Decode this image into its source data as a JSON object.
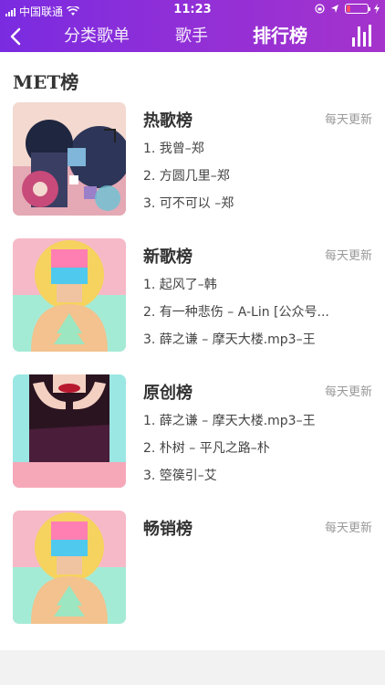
{
  "status": {
    "carrier": "中国联通",
    "time": "11:23"
  },
  "nav": {
    "back": "<",
    "tabs": [
      "分类歌单",
      "歌手",
      "排行榜"
    ],
    "active_index": 2
  },
  "section_title": "MET榜",
  "ranks": [
    {
      "name": "热歌榜",
      "update": "每天更新",
      "songs": [
        "1. 我曾–郑",
        "2. 方圆几里–郑",
        "3. 可不可以 –郑"
      ]
    },
    {
      "name": "新歌榜",
      "update": "每天更新",
      "songs": [
        "1. 起风了–韩",
        "2. 有一种悲伤 – A-Lin [公众号...",
        "3. 薛之谦 – 摩天大楼.mp3–王"
      ]
    },
    {
      "name": "原创榜",
      "update": "每天更新",
      "songs": [
        "1. 薛之谦 – 摩天大楼.mp3–王",
        "2. 朴树 – 平凡之路–朴",
        "3. 箜篌引–艾"
      ]
    },
    {
      "name": "畅销榜",
      "update": "每天更新",
      "songs": []
    }
  ],
  "colors": {
    "header_start": "#7a2be0",
    "header_end": "#a533cc"
  },
  "icons": [
    "back-chevron-icon",
    "equalizer-icon",
    "wifi-icon",
    "battery-icon",
    "location-icon"
  ]
}
